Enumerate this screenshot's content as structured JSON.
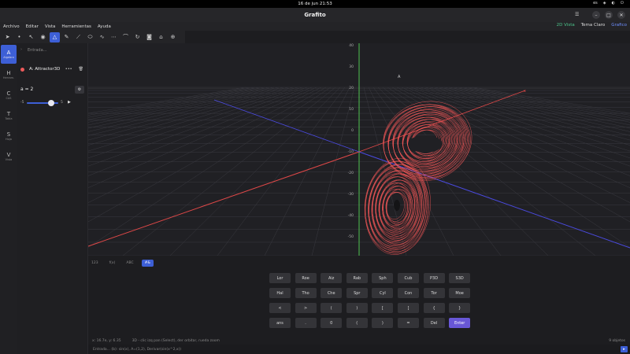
{
  "system": {
    "clock": "16 de jun  21:53",
    "lang": "es"
  },
  "window": {
    "title": "Grafito"
  },
  "menu": {
    "items": [
      "Archivo",
      "Editar",
      "Vista",
      "Herramientas",
      "Ayuda"
    ],
    "right": [
      "2D Vista",
      "Tema Claro",
      "Grafico"
    ]
  },
  "rail": [
    {
      "glyph": "A",
      "caption": "Algebra"
    },
    {
      "glyph": "H",
      "caption": "Herram."
    },
    {
      "glyph": "C",
      "caption": "CAS"
    },
    {
      "glyph": "T",
      "caption": "Tabla"
    },
    {
      "glyph": "S",
      "caption": "Hoja"
    },
    {
      "glyph": "V",
      "caption": "Vista"
    }
  ],
  "side": {
    "entrada_placeholder": "Entrada...",
    "object": {
      "label": "A: Attractor3D",
      "color": "#ee5a5a"
    },
    "param": "a = 2",
    "slider": {
      "min": "-5",
      "max": "5",
      "value": 2
    }
  },
  "view": {
    "point_label": "A",
    "axis_ticks_z": [
      "40",
      "30",
      "20",
      "10",
      "0",
      "-10",
      "-20",
      "-30",
      "-40",
      "-50"
    ],
    "x_label": "x"
  },
  "view_tabs": [
    "123",
    "f(x)",
    "ABC",
    "#&"
  ],
  "keypad": [
    [
      "Lor",
      "Roe",
      "Aiz",
      "Rab",
      "Sph",
      "Cub",
      "P3D",
      "S3D"
    ],
    [
      "Hal",
      "Tho",
      "Che",
      "Spr",
      "Cyl",
      "Con",
      "Tor",
      "Moe"
    ],
    [
      "<",
      ">",
      "(",
      ")",
      "[",
      "]",
      "{",
      "}"
    ],
    [
      "ans",
      ".",
      "0",
      "(",
      ")",
      "=",
      "Del",
      "Enter"
    ]
  ],
  "status": {
    "coords": "x: 16.7e, y: 6.35",
    "hint": "3D - clic izq pan (Select), der orbitar, rueda zoom",
    "count": "9 objetos"
  },
  "cmdline": {
    "placeholder": "Entrada... (b): sin(x), A=(1,2), Derivar(sin(x^2,x))"
  }
}
